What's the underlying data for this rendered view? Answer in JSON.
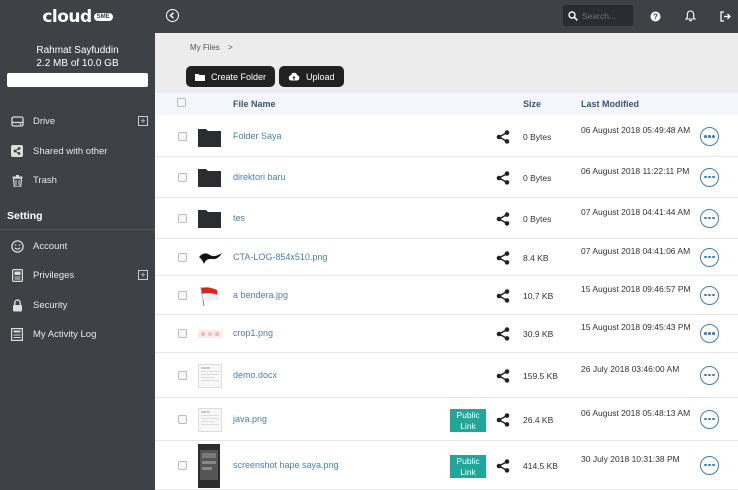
{
  "logo": {
    "text": "cloud",
    "sub": "SME"
  },
  "user": {
    "name": "Rahmat Sayfuddin",
    "quota": "2.2 MB of 10.0 GB"
  },
  "nav": [
    {
      "label": "Drive",
      "icon": "drive-icon",
      "expand": "+"
    },
    {
      "label": "Shared with other",
      "icon": "share-icon"
    },
    {
      "label": "Trash",
      "icon": "trash-icon"
    }
  ],
  "setting": {
    "title": "Setting",
    "items": [
      {
        "label": "Account",
        "icon": "smile-icon"
      },
      {
        "label": "Privileges",
        "icon": "id-card-icon",
        "expand": "+"
      },
      {
        "label": "Security",
        "icon": "lock-icon"
      },
      {
        "label": "My Activity Log",
        "icon": "log-icon"
      }
    ]
  },
  "topbar": {
    "search_placeholder": "Search..."
  },
  "breadcrumb": {
    "root": "My Files",
    "sep": ">"
  },
  "actions": {
    "create_folder": "Create Folder",
    "upload": "Upload"
  },
  "table": {
    "headers": {
      "name": "File Name",
      "size": "Size",
      "modified": "Last Modified"
    },
    "rows": [
      {
        "name": "Folder Saya",
        "type": "folder",
        "size": "0 Bytes",
        "modified": "06 August 2018 05:49:48 AM",
        "public": ""
      },
      {
        "name": "direktori baru",
        "type": "folder",
        "size": "0 Bytes",
        "modified": "06 August 2018 11:22:11 PM",
        "public": ""
      },
      {
        "name": "tes",
        "type": "folder",
        "size": "0 Bytes",
        "modified": "07 August 2018 04:41:44 AM",
        "public": ""
      },
      {
        "name": "CTA-LOG-854x510.png",
        "type": "logo",
        "size": "8.4 KB",
        "modified": "07 August 2018 04:41:06 AM",
        "public": ""
      },
      {
        "name": "a bendera.jpg",
        "type": "flag",
        "size": "10.7 KB",
        "modified": "15 August 2018 09:46:57 PM",
        "public": ""
      },
      {
        "name": "crop1.png",
        "type": "crop",
        "size": "30.9 KB",
        "modified": "15 August 2018 09:45:43 PM",
        "public": ""
      },
      {
        "name": "demo.docx",
        "type": "doc",
        "size": "159.5 KB",
        "modified": "26 July 2018 03:46:00 AM",
        "public": ""
      },
      {
        "name": "java.png",
        "type": "doc",
        "size": "26.4 KB",
        "modified": "06 August 2018 05:48:13 AM",
        "public": "Public Link"
      },
      {
        "name": "screenshot hape saya.png",
        "type": "phone",
        "size": "414.5 KB",
        "modified": "30 July 2018 10:31:38 PM",
        "public": "Public Link"
      }
    ]
  }
}
